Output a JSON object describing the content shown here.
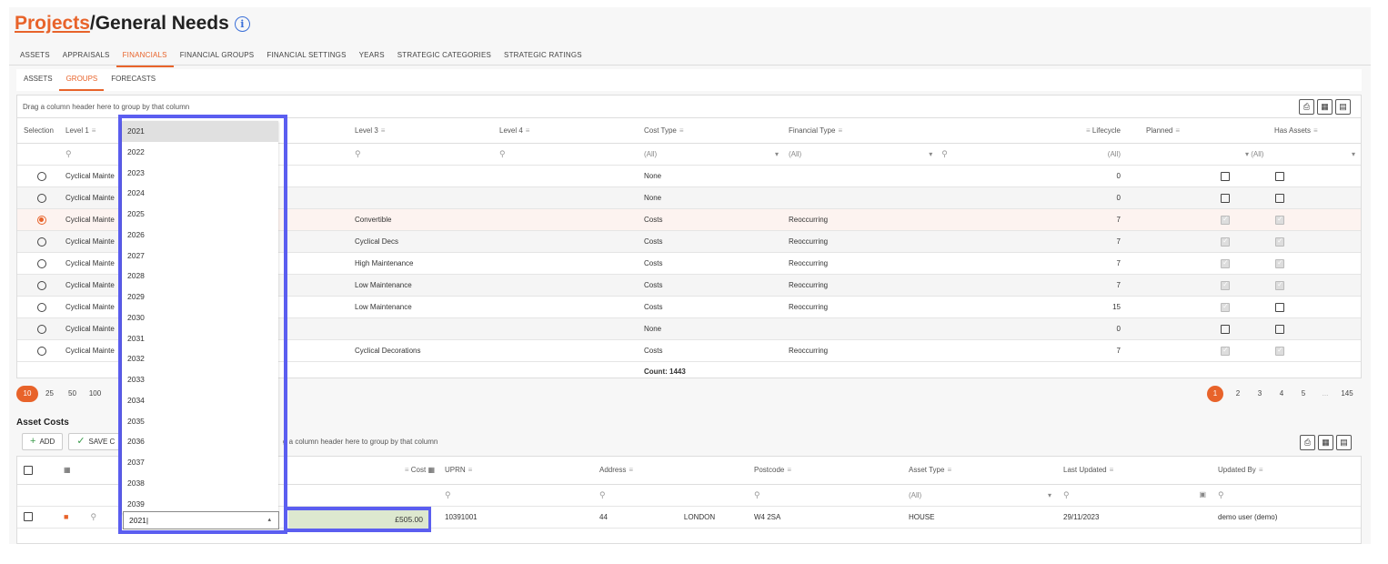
{
  "title": {
    "link": "Projects",
    "rest": "/General Needs",
    "info_icon": "info-icon"
  },
  "main_tabs": [
    "ASSETS",
    "APPRAISALS",
    "FINANCIALS",
    "FINANCIAL GROUPS",
    "FINANCIAL SETTINGS",
    "YEARS",
    "STRATEGIC CATEGORIES",
    "STRATEGIC RATINGS"
  ],
  "sub_tabs": [
    "ASSETS",
    "GROUPS",
    "FORECASTS"
  ],
  "groups_grid": {
    "group_hint": "Drag a column header here to group by that column",
    "columns": [
      "Selection",
      "Level 1",
      "Level 3",
      "Level 4",
      "Cost Type",
      "Financial Type",
      "Lifecycle",
      "Planned",
      "Has Assets"
    ],
    "filters": {
      "cost_type": "(All)",
      "financial_type": "(All)",
      "lifecycle": "(All)",
      "planned": "(All)"
    },
    "rows": [
      {
        "level1": "Cyclical Mainte",
        "level3": "",
        "cost_type": "None",
        "financial_type": "",
        "lifecycle": "0",
        "planned": false,
        "has_assets": false,
        "selected": false
      },
      {
        "level1": "Cyclical Mainte",
        "level3": "",
        "cost_type": "None",
        "financial_type": "",
        "lifecycle": "0",
        "planned": false,
        "has_assets": false,
        "selected": false
      },
      {
        "level1": "Cyclical Mainte",
        "level3": "Convertible",
        "cost_type": "Costs",
        "financial_type": "Reoccurring",
        "lifecycle": "7",
        "planned": true,
        "has_assets": true,
        "selected": true
      },
      {
        "level1": "Cyclical Mainte",
        "level3": "Cyclical Decs",
        "cost_type": "Costs",
        "financial_type": "Reoccurring",
        "lifecycle": "7",
        "planned": true,
        "has_assets": true,
        "selected": false
      },
      {
        "level1": "Cyclical Mainte",
        "level3": "High Maintenance",
        "cost_type": "Costs",
        "financial_type": "Reoccurring",
        "lifecycle": "7",
        "planned": true,
        "has_assets": true,
        "selected": false
      },
      {
        "level1": "Cyclical Mainte",
        "level3": "Low Maintenance",
        "cost_type": "Costs",
        "financial_type": "Reoccurring",
        "lifecycle": "7",
        "planned": true,
        "has_assets": true,
        "selected": false
      },
      {
        "level1": "Cyclical Mainte",
        "level3": "Low Maintenance",
        "cost_type": "Costs",
        "financial_type": "Reoccurring",
        "lifecycle": "15",
        "planned": true,
        "has_assets": false,
        "selected": false
      },
      {
        "level1": "Cyclical Mainte",
        "level3": "",
        "cost_type": "None",
        "financial_type": "",
        "lifecycle": "0",
        "planned": false,
        "has_assets": false,
        "selected": false
      },
      {
        "level1": "Cyclical Mainte",
        "level3": "Cyclical Decorations",
        "cost_type": "Costs",
        "financial_type": "Reoccurring",
        "lifecycle": "7",
        "planned": true,
        "has_assets": true,
        "selected": false
      }
    ],
    "footer_count": "Count: 1443",
    "page_sizes": [
      "10",
      "25",
      "50",
      "100"
    ],
    "pages": [
      "1",
      "2",
      "3",
      "4",
      "5",
      "...",
      "145"
    ]
  },
  "asset_costs": {
    "heading": "Asset Costs",
    "add_label": "ADD",
    "save_label": "SAVE C",
    "group_hint": "g a column header here to group by that column",
    "columns": [
      "Cost",
      "UPRN",
      "Address",
      "Postcode",
      "Asset Type",
      "Last Updated",
      "Updated By"
    ],
    "asset_type_filter": "(All)",
    "row": {
      "year": "2021",
      "cost": "£505.00",
      "uprn": "10391001",
      "address_num": "44",
      "address_city": "LONDON",
      "postcode": "W4 2SA",
      "asset_type": "HOUSE",
      "last_updated": "29/11/2023",
      "updated_by": "demo user (demo)"
    }
  },
  "year_dropdown": {
    "options": [
      "2021",
      "2022",
      "2023",
      "2024",
      "2025",
      "2026",
      "2027",
      "2028",
      "2029",
      "2030",
      "2031",
      "2032",
      "2033",
      "2034",
      "2035",
      "2036",
      "2037",
      "2038",
      "2039"
    ],
    "selected": "2021",
    "input_value": "2021|"
  },
  "colors": {
    "accent": "#e8632a",
    "highlight": "#5b5ef0",
    "cost_bg": "#dde8cf"
  }
}
